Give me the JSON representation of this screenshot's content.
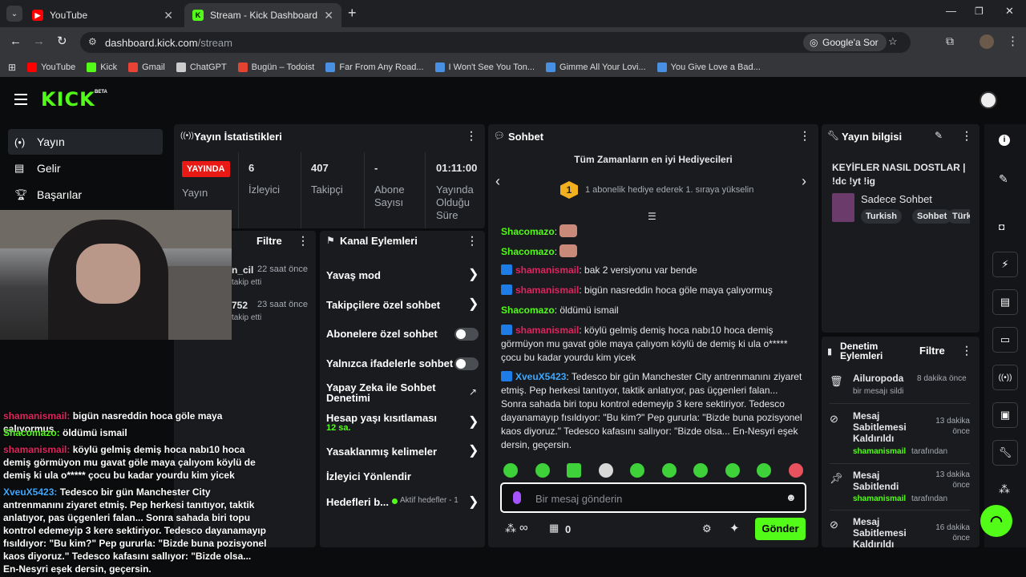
{
  "browser": {
    "tabs": [
      {
        "label": "YouTube"
      },
      {
        "label": "Stream - Kick Dashboard"
      }
    ],
    "url_host": "dashboard.kick.com",
    "url_path": "/stream",
    "lens_label": "Google'a Sor",
    "bookmarks": [
      {
        "label": "YouTube",
        "color": "#ff0000"
      },
      {
        "label": "Kick",
        "color": "#53fc18"
      },
      {
        "label": "Gmail",
        "color": "#ea4335"
      },
      {
        "label": "ChatGPT",
        "color": "#cccccc"
      },
      {
        "label": "Bugün – Todoist",
        "color": "#e44332"
      },
      {
        "label": "Far From Any Road...",
        "color": "#4a90e2"
      },
      {
        "label": "I Won't See You Ton...",
        "color": "#4a90e2"
      },
      {
        "label": "Gimme All Your Lovi...",
        "color": "#4a90e2"
      },
      {
        "label": "You Give Love a Bad...",
        "color": "#4a90e2"
      }
    ]
  },
  "app": {
    "logo": "KICK",
    "beta": "BETA"
  },
  "nav": [
    {
      "label": "Yayın",
      "icon": "broadcast-icon"
    },
    {
      "label": "Gelir",
      "icon": "chart-icon"
    },
    {
      "label": "Başarılar",
      "icon": "trophy-icon"
    }
  ],
  "stats": {
    "title": "Yayın İstatistikleri",
    "live_badge": "YAYINDA",
    "live_label": "Yayın",
    "items": [
      {
        "value": "6",
        "label": "İzleyici"
      },
      {
        "value": "407",
        "label": "Takipçi"
      },
      {
        "value": "-",
        "label": "Abone Sayısı"
      },
      {
        "value": "01:11:00",
        "label": "Yayında Olduğu Süre"
      }
    ]
  },
  "activity": {
    "filter_label": "Filtre",
    "items": [
      {
        "name": "n_cil",
        "time": "22 saat önce",
        "desc": "takip etti"
      },
      {
        "name": "752",
        "time": "23 saat önce",
        "desc": "takip etti"
      }
    ]
  },
  "channel_actions": {
    "title": "Kanal Eylemleri",
    "items": [
      {
        "label": "Yavaş mod"
      },
      {
        "label": "Takipçilere özel sohbet"
      },
      {
        "label": "Abonelere özel sohbet"
      },
      {
        "label": "Yalnızca ifadelerle sohbet"
      },
      {
        "label": "Yapay Zeka ile Sohbet Denetimi"
      },
      {
        "label": "Hesap yaşı kısıtlaması",
        "sub": "12 sa."
      },
      {
        "label": "Yasaklanmış kelimeler"
      },
      {
        "label": "İzleyici Yönlendir"
      },
      {
        "label": "Hedefleri b...",
        "status": "Aktif hedefler - 1"
      }
    ]
  },
  "chat": {
    "title": "Sohbet",
    "gifters_title": "Tüm Zamanların en iyi Hediyecileri",
    "gifters_rank": "1",
    "gifters_text": "1 abonelik hediye ederek 1. sıraya yükselin",
    "messages": [
      {
        "user": "Shacomazo",
        "text": "",
        "color": "#53fc18",
        "badge": false
      },
      {
        "user": "Shacomazo",
        "text": "",
        "color": "#53fc18",
        "badge": false
      },
      {
        "user": "shamanismail",
        "text": "bak 2 versiyonu var bende",
        "color": "#e0245e",
        "badge": true
      },
      {
        "user": "shamanismail",
        "text": "bigün nasreddin hoca göle maya çalıyormuş",
        "color": "#e0245e",
        "badge": true
      },
      {
        "user": "Shacomazo",
        "text": "öldümü ismail",
        "color": "#53fc18",
        "badge": false
      },
      {
        "user": "shamanismail",
        "text": "köylü gelmiş demiş hoca nabı10 hoca demiş görmüyon mu gavat göle maya çalıyom köylü de demiş ki ula o***** çocu bu kadar yourdu kim yicek",
        "color": "#e0245e",
        "badge": true
      },
      {
        "user": "XveuX5423",
        "text": "Tedesco bir gün Manchester City antrenmanını ziyaret etmiş. Pep herkesi tanıtıyor, taktik anlatıyor, pas üçgenleri falan... Sonra sahada biri topu kontrol edemeyip 3 kere sektiriyor. Tedesco dayanamayıp fısıldıyor: \"Bu kim?\" Pep gururla: \"Bizde buna pozisyonel kaos diyoruz.\" Tedesco kafasını sallıyor: \"Bizde olsa... En-Nesyri eşek dersin, geçersin.",
        "color": "#3da8ff",
        "badge": true
      }
    ],
    "input_placeholder": "Bir mesaj gönderin",
    "points_value": "∞",
    "gift_count": "0",
    "send_label": "Gönder"
  },
  "stream_info": {
    "title": "Yayın bilgisi",
    "stream_title": "KEYİFLER NASIL DOSTLAR | !dc !yt !ig",
    "category": "Sadece Sohbet",
    "tags": [
      "Turkish",
      "Sohbet",
      "Türk"
    ]
  },
  "mod_log": {
    "title": "Denetim Eylemleri",
    "filter_label": "Filtre",
    "items": [
      {
        "title": "Ailuropoda",
        "time": "8 dakika önce",
        "desc": "bir mesajı sildi",
        "icon": "trash-icon"
      },
      {
        "title": "Mesaj Sabitlemesi Kaldırıldı",
        "time": "13 dakika önce",
        "user": "shamanismail",
        "by": "tarafından",
        "icon": "unpin-icon"
      },
      {
        "title": "Mesaj Sabitlendi",
        "time": "13 dakika önce",
        "user": "shamanismail",
        "by": "tarafından",
        "icon": "pin-icon"
      },
      {
        "title": "Mesaj Sabitlemesi Kaldırıldı",
        "time": "16 dakika önce",
        "icon": "unpin-icon"
      }
    ]
  },
  "overlay_chat": [
    {
      "user": "shamanismail:",
      "text": "bigün nasreddin hoca göle maya çalıyormuş",
      "color": "#e0245e"
    },
    {
      "user": "Shacomazo:",
      "text": "öldümü ismail",
      "color": "#53fc18"
    },
    {
      "user": "shamanismail:",
      "text": "köylü gelmiş demiş hoca nabı10 hoca demiş görmüyon mu gavat göle maya çalıyom köylü de demiş ki ula o***** çocu bu kadar yourdu kim yicek",
      "color": "#e0245e"
    },
    {
      "user": "XveuX5423:",
      "text": "Tedesco bir gün Manchester City antrenmanını ziyaret etmiş. Pep herkesi tanıtıyor, taktik anlatıyor, pas üçgenleri falan... Sonra sahada biri topu kontrol edemeyip 3 kere sektiriyor. Tedesco dayanamayıp fısıldıyor: \"Bu kim?\" Pep gururla: \"Bizde buna pozisyonel kaos diyoruz.\" Tedesco kafasını sallıyor: \"Bizde olsa... En-Nesyri eşek dersin, geçersin.",
      "color": "#3da8ff"
    }
  ],
  "colors": {
    "accent": "#53fc18",
    "live": "#e91916",
    "panel": "#191b1f"
  }
}
